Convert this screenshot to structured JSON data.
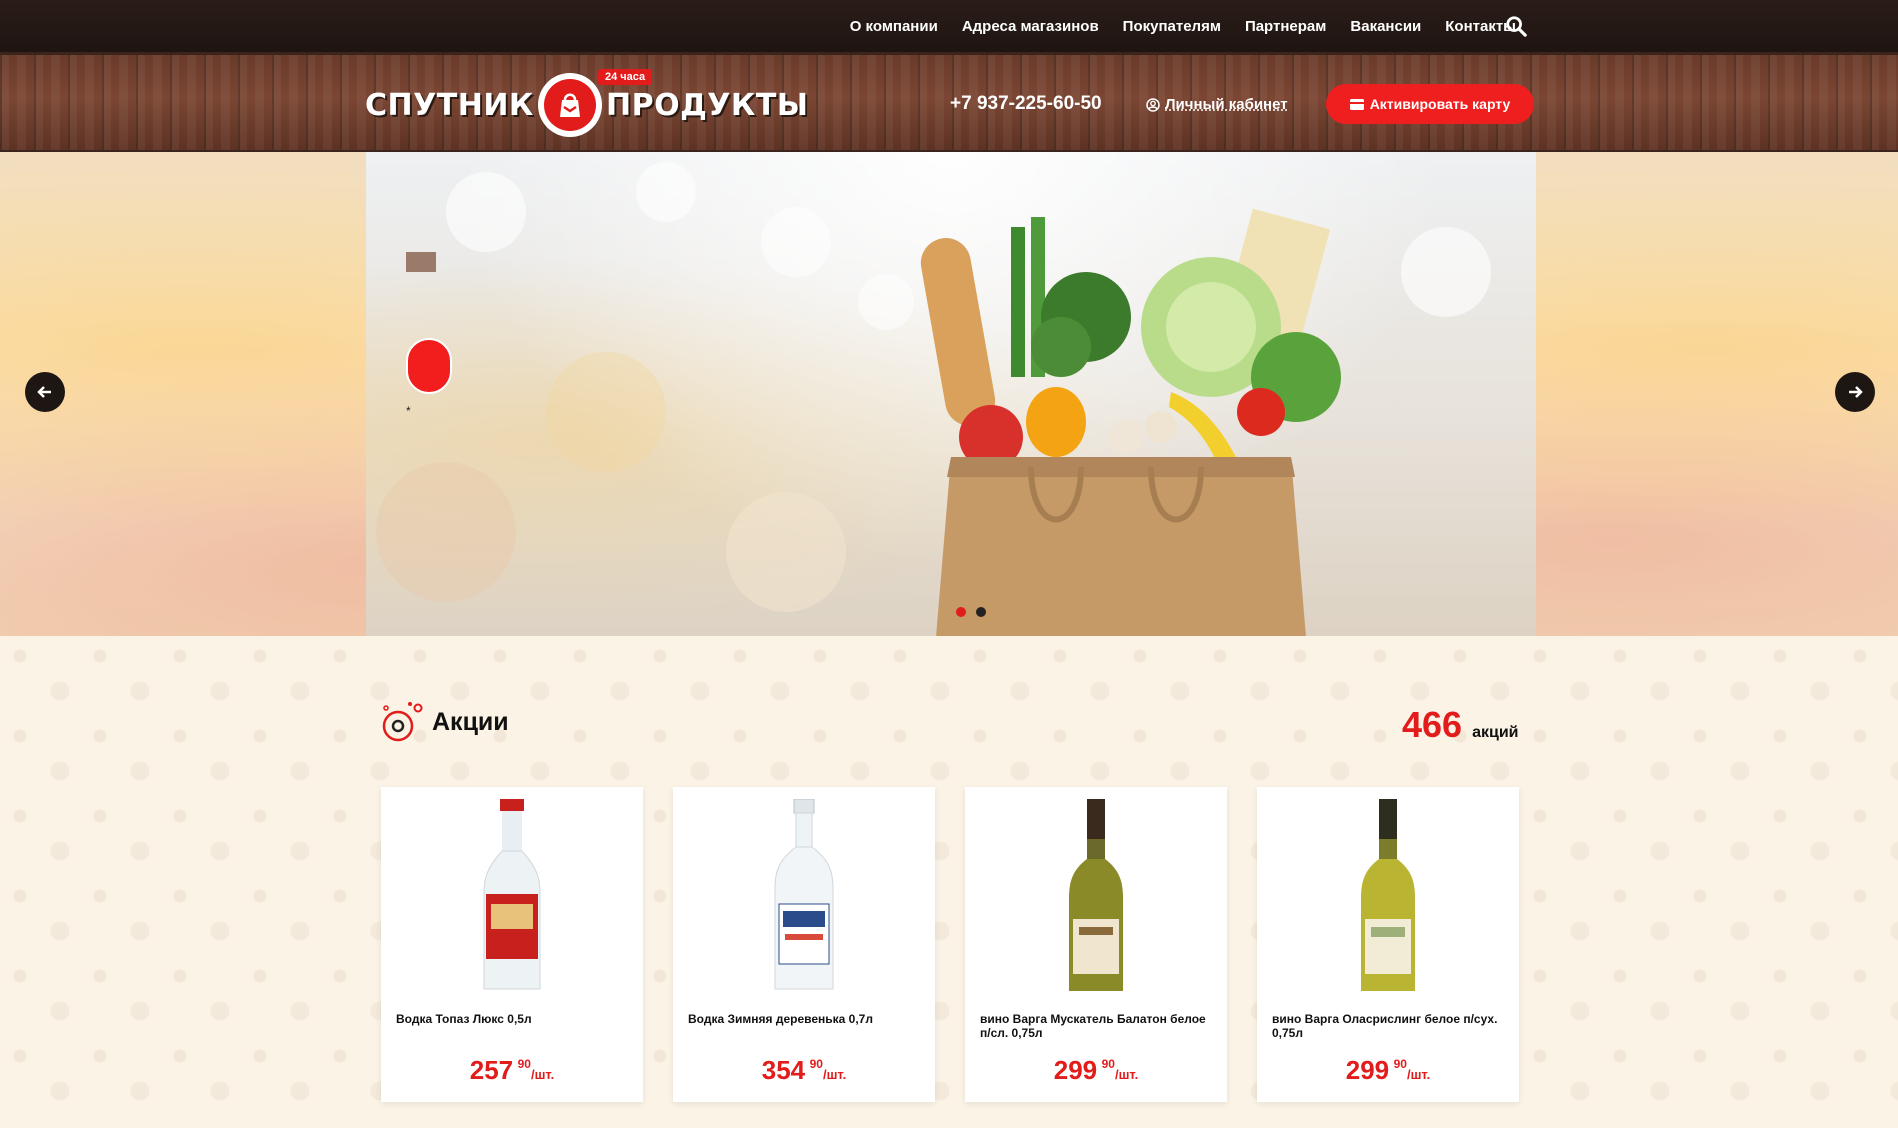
{
  "nav": {
    "links": [
      "О компании",
      "Адреса магазинов",
      "Покупателям",
      "Партнерам",
      "Вакансии",
      "Контакты"
    ],
    "search_icon": "search-icon"
  },
  "header": {
    "logo_left": "СПУТНИК",
    "logo_right": "ПРОДУКТЫ",
    "logo_badge": "24 часа",
    "phone": "+7 937-225-60-50",
    "cabinet_label": "Личный кабинет",
    "activate_label": "Активировать карту"
  },
  "hero": {
    "star": "*",
    "slides_total": 2,
    "active_slide": 1
  },
  "promos": {
    "title": "Акции",
    "count": "466",
    "count_unit": "акций",
    "items": [
      {
        "name": "Водка Топаз Люкс 0,5л",
        "price_rub": "257",
        "price_kop": "90",
        "per": "/шт."
      },
      {
        "name": "Водка Зимняя деревенька 0,7л",
        "price_rub": "354",
        "price_kop": "90",
        "per": "/шт."
      },
      {
        "name": "вино Варга Мускатель Балатон белое п/сл. 0,75л",
        "price_rub": "299",
        "price_kop": "90",
        "per": "/шт."
      },
      {
        "name": "вино Варга Оласрислинг белое п/сух. 0,75л",
        "price_rub": "299",
        "price_kop": "90",
        "per": "/шт."
      }
    ]
  },
  "colors": {
    "accent": "#e21b1b",
    "nav_bg": "#1e1411",
    "wood": "#6a3a2a",
    "page_bg": "#faf3e6"
  }
}
